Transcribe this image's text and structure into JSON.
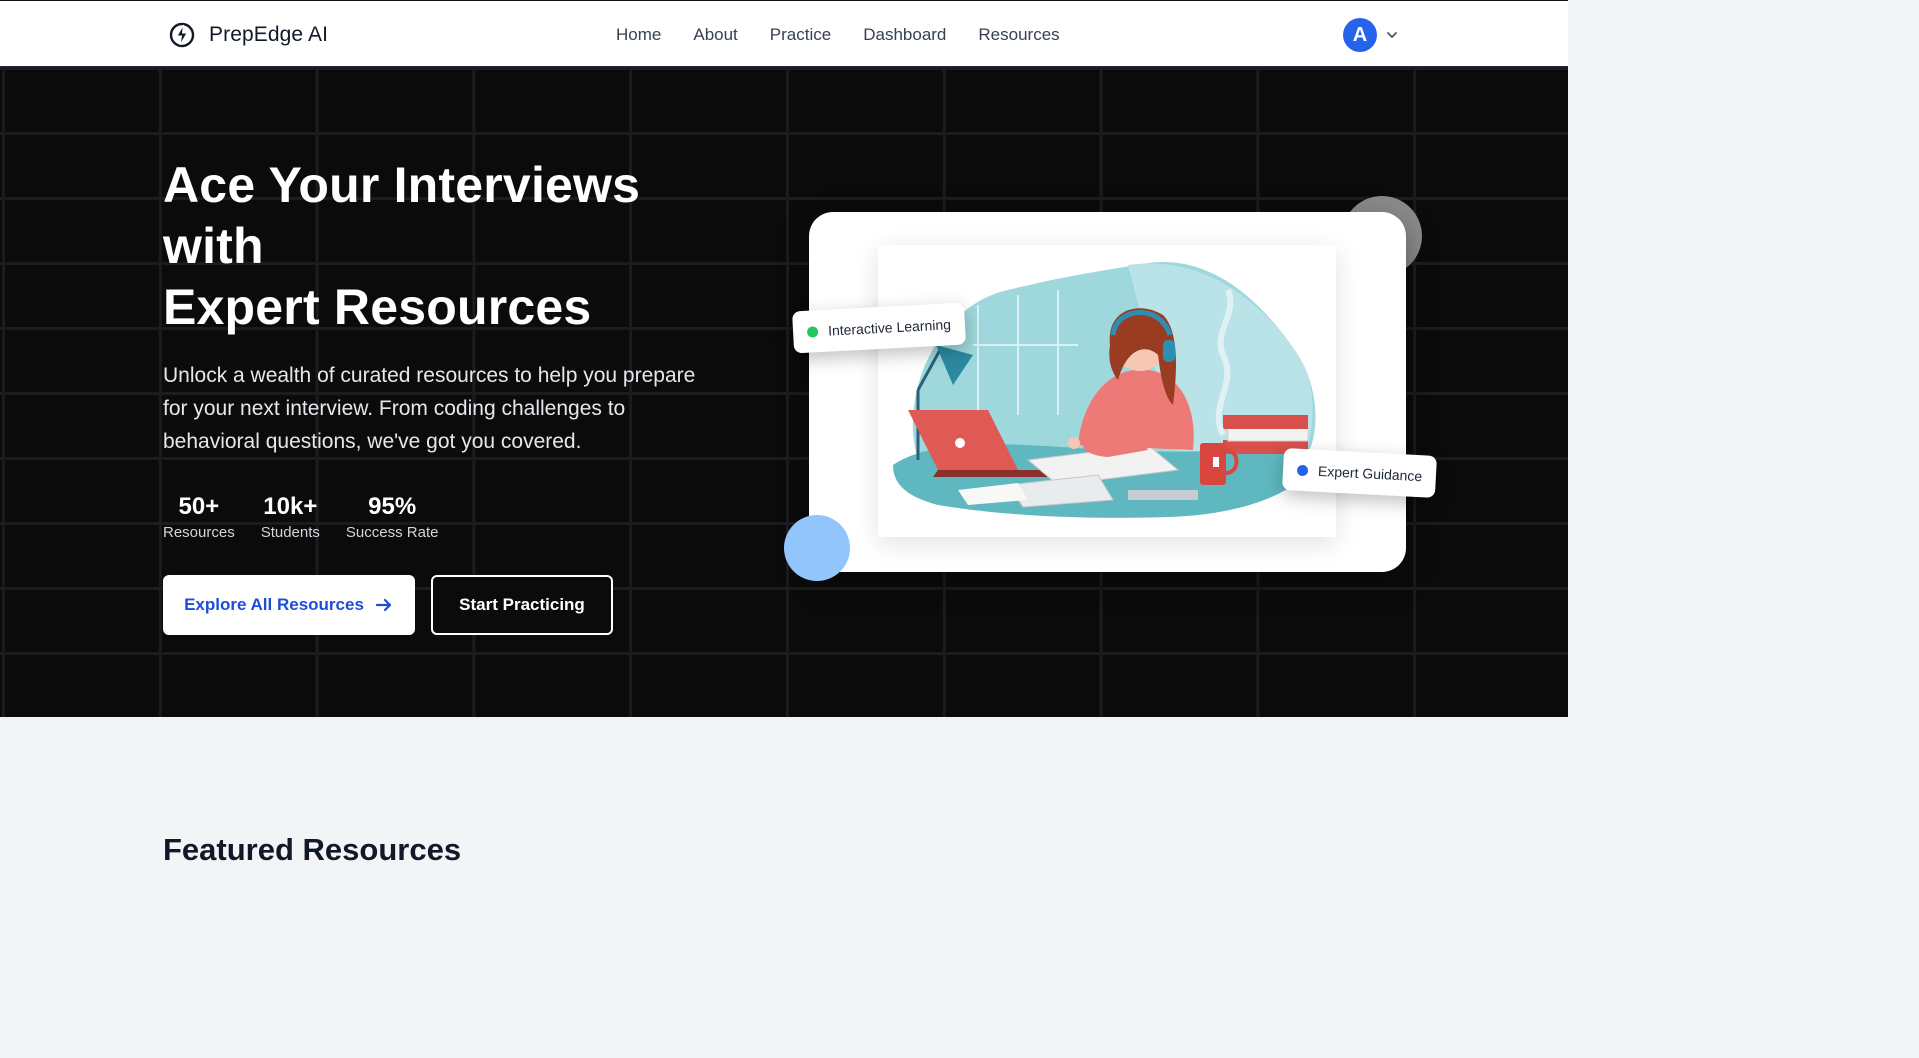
{
  "brand": {
    "name": "PrepEdge AI",
    "logo_icon": "bolt-circle-icon"
  },
  "nav": {
    "items": [
      {
        "label": "Home"
      },
      {
        "label": "About"
      },
      {
        "label": "Practice"
      },
      {
        "label": "Dashboard"
      },
      {
        "label": "Resources"
      }
    ]
  },
  "user": {
    "avatar_letter": "A",
    "menu_icon": "chevron-down-icon",
    "avatar_color": "#2563eb"
  },
  "hero": {
    "title_lines": [
      "Ace Your Interviews",
      "with",
      "Expert Resources"
    ],
    "description": "Unlock a wealth of curated resources to help you prepare for your next interview. From coding challenges to behavioral questions, we've got you covered.",
    "stats": [
      {
        "value": "50+",
        "label": "Resources"
      },
      {
        "value": "10k+",
        "label": "Students"
      },
      {
        "value": "95%",
        "label": "Success Rate"
      }
    ],
    "primary_button": {
      "label": "Explore All Resources",
      "icon": "arrow-right-icon"
    },
    "secondary_button": {
      "label": "Start Practicing"
    },
    "badges": [
      {
        "label": "Interactive Learning",
        "dot_color": "#22c55e"
      },
      {
        "label": "Expert Guidance",
        "dot_color": "#2563eb"
      }
    ]
  },
  "featured": {
    "title": "Featured Resources"
  },
  "colors": {
    "hero_bg": "#0b0b0c",
    "accent": "#1d4ed8",
    "page_bg": "#f3f4f6"
  }
}
